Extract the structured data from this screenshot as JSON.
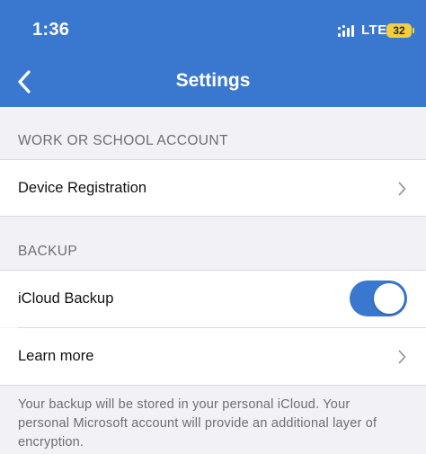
{
  "status_bar": {
    "time": "1:36",
    "network": "LTE",
    "battery": "32",
    "signal_icon": "signal-bars-icon"
  },
  "nav": {
    "title": "Settings",
    "back_icon": "chevron-left-icon"
  },
  "sections": {
    "work_account": {
      "header": "WORK OR SCHOOL ACCOUNT",
      "device_registration_label": "Device Registration"
    },
    "backup": {
      "header": "BACKUP",
      "icloud_backup_label": "iCloud Backup",
      "icloud_backup_enabled": true,
      "learn_more_label": "Learn more",
      "footer": "Your backup will be stored in your personal iCloud. Your personal Microsoft account will provide an additional layer of encryption."
    }
  },
  "colors": {
    "accent": "#3a78cf",
    "battery": "#f1cf3f",
    "background": "#f2f2f6",
    "secondary_text": "#6d6d72"
  }
}
